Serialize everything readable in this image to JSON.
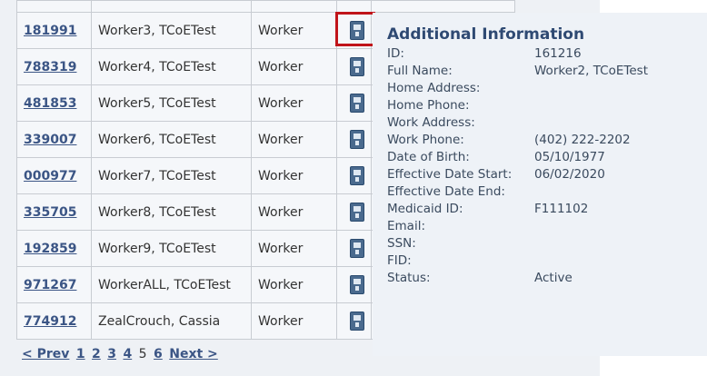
{
  "rows": [
    {
      "id": "181991",
      "name": "Worker3, TCoETest",
      "role": "Worker"
    },
    {
      "id": "788319",
      "name": "Worker4, TCoETest",
      "role": "Worker"
    },
    {
      "id": "481853",
      "name": "Worker5, TCoETest",
      "role": "Worker"
    },
    {
      "id": "339007",
      "name": "Worker6, TCoETest",
      "role": "Worker"
    },
    {
      "id": "000977",
      "name": "Worker7, TCoETest",
      "role": "Worker"
    },
    {
      "id": "335705",
      "name": "Worker8, TCoETest",
      "role": "Worker"
    },
    {
      "id": "192859",
      "name": "Worker9, TCoETest",
      "role": "Worker"
    },
    {
      "id": "971267",
      "name": "WorkerALL, TCoETest",
      "role": "Worker"
    },
    {
      "id": "774912",
      "name": "ZealCrouch, Cassia",
      "role": "Worker"
    }
  ],
  "pager": {
    "prev": "< Prev",
    "pages": [
      "1",
      "2",
      "3",
      "4",
      "5",
      "6"
    ],
    "current": "5",
    "next": "Next >"
  },
  "popup": {
    "title": "Additional Information",
    "fields": [
      {
        "label": "ID:",
        "value": "161216"
      },
      {
        "label": "Full Name:",
        "value": "Worker2, TCoETest"
      },
      {
        "label": "Home Address:",
        "value": ""
      },
      {
        "label": "Home Phone:",
        "value": ""
      },
      {
        "label": "Work Address:",
        "value": ""
      },
      {
        "label": "Work Phone:",
        "value": "(402) 222-2202"
      },
      {
        "label": "Date of Birth:",
        "value": "05/10/1977"
      },
      {
        "label": "Effective Date Start:",
        "value": "06/02/2020"
      },
      {
        "label": "Effective Date End:",
        "value": ""
      },
      {
        "label": "Medicaid ID:",
        "value": "F111102"
      },
      {
        "label": "Email:",
        "value": ""
      },
      {
        "label": "SSN:",
        "value": ""
      },
      {
        "label": "FID:",
        "value": ""
      },
      {
        "label": "Status:",
        "value": "Active"
      }
    ]
  },
  "icons": {
    "info_button": "id-card-icon"
  },
  "colors": {
    "highlight": "#c0141a",
    "link": "#3b5585",
    "popup_title": "#2f4a73"
  }
}
